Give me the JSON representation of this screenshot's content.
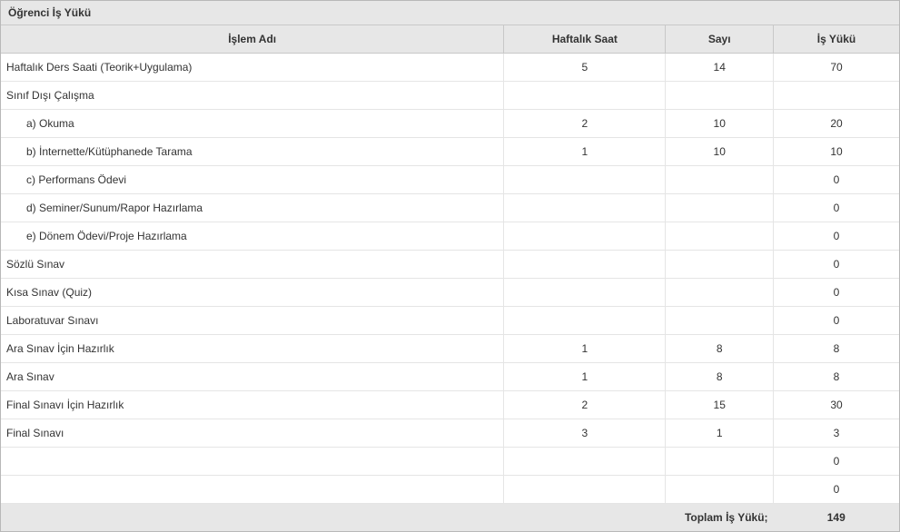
{
  "title": "Öğrenci İş Yükü",
  "headers": {
    "name": "İşlem Adı",
    "hours": "Haftalık Saat",
    "count": "Sayı",
    "workload": "İş Yükü"
  },
  "rows": [
    {
      "name": "Haftalık Ders Saati (Teorik+Uygulama)",
      "hours": "5",
      "count": "14",
      "workload": "70",
      "indent": 0
    },
    {
      "name": "Sınıf Dışı Çalışma",
      "hours": "",
      "count": "",
      "workload": "",
      "indent": 0
    },
    {
      "name": "a) Okuma",
      "hours": "2",
      "count": "10",
      "workload": "20",
      "indent": 1
    },
    {
      "name": "b) İnternette/Kütüphanede Tarama",
      "hours": "1",
      "count": "10",
      "workload": "10",
      "indent": 1
    },
    {
      "name": "c) Performans Ödevi",
      "hours": "",
      "count": "",
      "workload": "0",
      "indent": 1
    },
    {
      "name": "d) Seminer/Sunum/Rapor Hazırlama",
      "hours": "",
      "count": "",
      "workload": "0",
      "indent": 1
    },
    {
      "name": "e) Dönem Ödevi/Proje Hazırlama",
      "hours": "",
      "count": "",
      "workload": "0",
      "indent": 1
    },
    {
      "name": "Sözlü Sınav",
      "hours": "",
      "count": "",
      "workload": "0",
      "indent": 0
    },
    {
      "name": "Kısa Sınav (Quiz)",
      "hours": "",
      "count": "",
      "workload": "0",
      "indent": 0
    },
    {
      "name": "Laboratuvar Sınavı",
      "hours": "",
      "count": "",
      "workload": "0",
      "indent": 0
    },
    {
      "name": "Ara Sınav İçin Hazırlık",
      "hours": "1",
      "count": "8",
      "workload": "8",
      "indent": 0
    },
    {
      "name": "Ara Sınav",
      "hours": "1",
      "count": "8",
      "workload": "8",
      "indent": 0
    },
    {
      "name": "Final Sınavı İçin Hazırlık",
      "hours": "2",
      "count": "15",
      "workload": "30",
      "indent": 0
    },
    {
      "name": "Final Sınavı",
      "hours": "3",
      "count": "1",
      "workload": "3",
      "indent": 0
    },
    {
      "name": "",
      "hours": "",
      "count": "",
      "workload": "0",
      "indent": 0
    },
    {
      "name": "",
      "hours": "",
      "count": "",
      "workload": "0",
      "indent": 0
    }
  ],
  "footer": {
    "label": "Toplam İş Yükü;",
    "total": "149"
  }
}
